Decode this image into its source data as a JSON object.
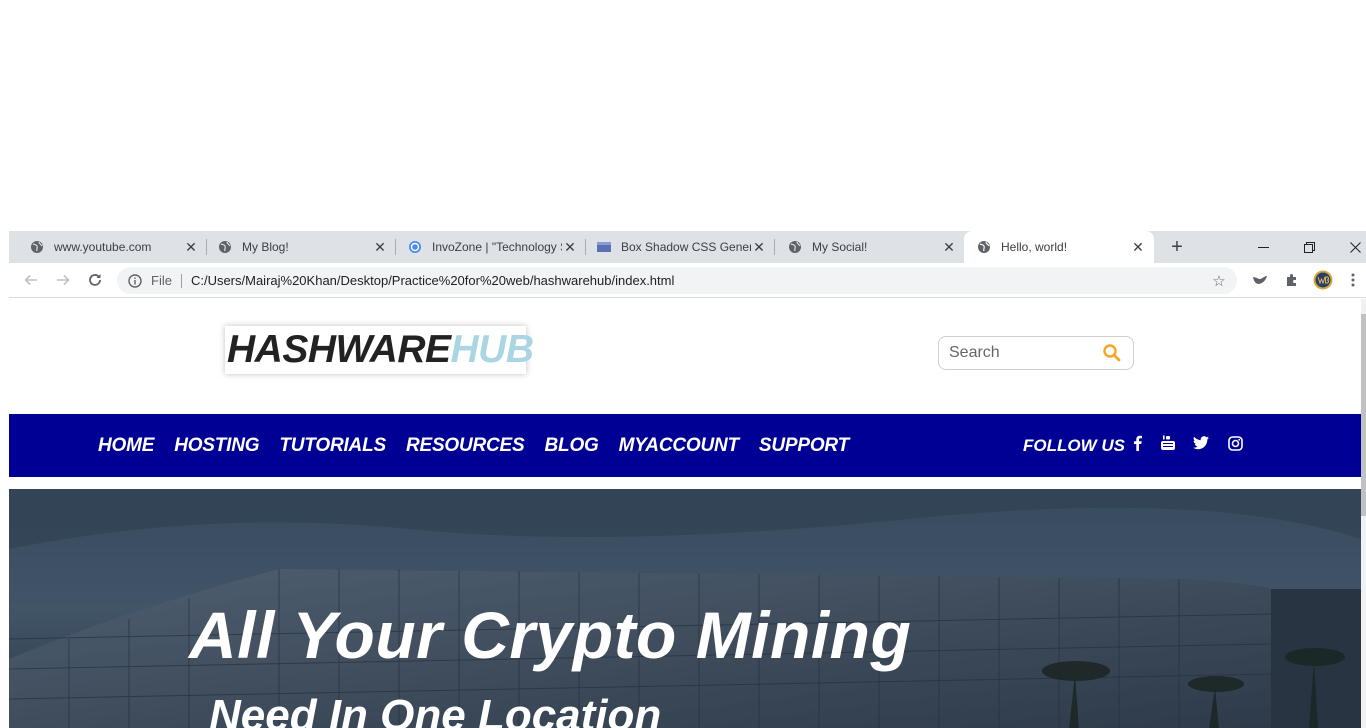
{
  "browser": {
    "tabs": [
      {
        "title": "www.youtube.com",
        "icon": "globe-icon"
      },
      {
        "title": "My Blog!",
        "icon": "globe-icon"
      },
      {
        "title": "InvoZone | \"Technology Solutions\"",
        "icon": "invozone-icon"
      },
      {
        "title": "Box Shadow CSS Generator",
        "icon": "box-shadow-site-icon"
      },
      {
        "title": "My Social!",
        "icon": "globe-icon"
      },
      {
        "title": "Hello, world!",
        "icon": "globe-icon",
        "active": true
      }
    ],
    "omnibox": {
      "scheme_label": "File",
      "url": "C:/Users/Mairaj%20Khan/Desktop/Practice%20for%20web/hashwarehub/index.html"
    }
  },
  "site": {
    "logo": {
      "part1": "HASHWARE",
      "part2": "HUB"
    },
    "search": {
      "placeholder": "Search"
    },
    "nav": [
      "HOME",
      "HOSTING",
      "TUTORIALS",
      "RESOURCES",
      "BLOG",
      "MYACCOUNT",
      "SUPPORT"
    ],
    "follow_label": "FOLLOW US",
    "social": [
      "facebook-icon",
      "youtube-icon",
      "twitter-icon",
      "instagram-icon"
    ],
    "hero": {
      "headline": "All Your Crypto Mining",
      "subheadline": "Need In One Location"
    }
  },
  "colors": {
    "nav_bg": "#000095",
    "logo_accent": "#a9d6e2",
    "search_icon": "#f5a623"
  }
}
